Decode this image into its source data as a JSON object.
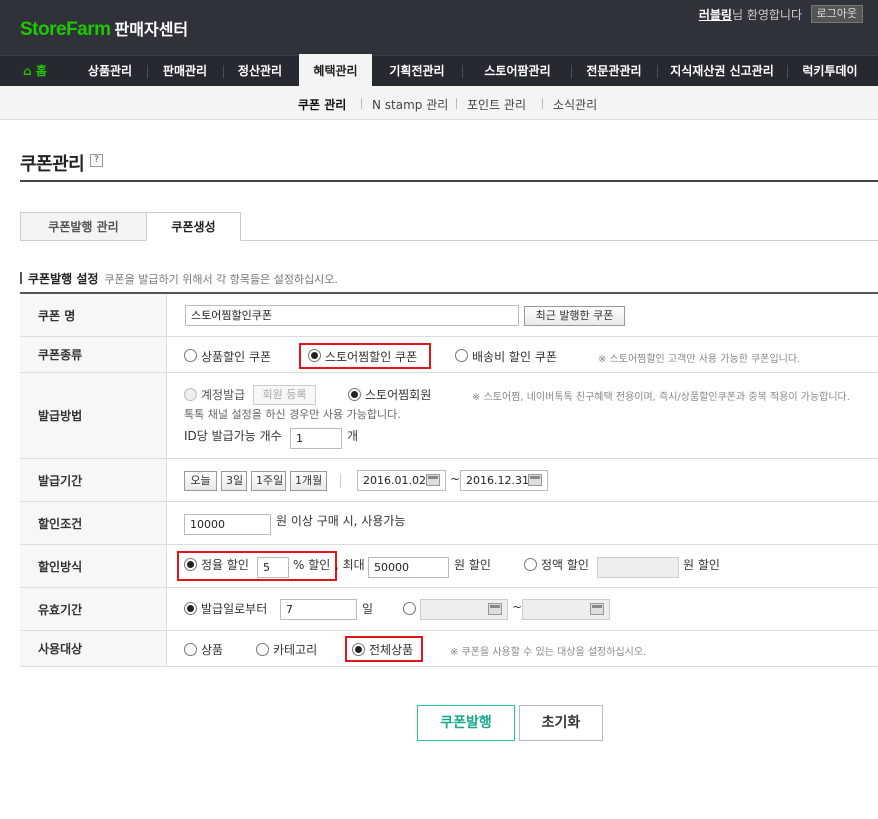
{
  "header": {
    "logo_brand": "StoreFarm",
    "logo_suffix": "판매자센터",
    "user_name": "러블링",
    "welcome_suffix": "님 환영합니다",
    "logout_label": "로그아웃"
  },
  "main_nav": {
    "home_label": "홈",
    "items": [
      "상품관리",
      "판매관리",
      "정산관리",
      "혜택관리",
      "기획전관리",
      "스토어팜관리",
      "전문관관리",
      "지식재산권 신고관리",
      "럭키투데이"
    ],
    "active": "혜택관리"
  },
  "sub_nav": {
    "items": [
      "쿠폰 관리",
      "N stamp 관리",
      "포인트 관리",
      "소식관리"
    ],
    "active": "쿠폰 관리"
  },
  "page": {
    "title": "쿠폰관리",
    "help": "?",
    "tabs": [
      "쿠폰발행 관리",
      "쿠폰생성"
    ],
    "active_tab": "쿠폰생성",
    "section_title": "쿠폰발행 설정",
    "section_desc": "쿠폰을 발급하기 위해서 각 항목들은 설정하십시오."
  },
  "form": {
    "coupon_name": {
      "label": "쿠폰 명",
      "value": "스토어찜할인쿠폰",
      "recent_button": "최근 발행한 쿠폰"
    },
    "coupon_type": {
      "label": "쿠폰종류",
      "options": [
        "상품할인 쿠폰",
        "스토어찜할인 쿠폰",
        "배송비 할인 쿠폰"
      ],
      "selected": "스토어찜할인 쿠폰",
      "note": "※ 스토어찜할인 고객만 사용 가능한 쿠폰입니다."
    },
    "issue_method": {
      "label": "발급방법",
      "option_account": "계정발급",
      "member_register_button": "회원 등록",
      "option_store": "스토어찜회원",
      "selected": "스토어찜회원",
      "note": "※ 스토어찜, 네이버톡톡 친구혜택 전용이며, 즉시/상품할인쿠폰과 중복 적용이 가능합니다.",
      "note2": "톡톡 채널 설정을 하신 경우만 사용 가능합니다.",
      "per_id_label": "ID당 발급가능 개수",
      "per_id_value": "1",
      "per_id_unit": "개"
    },
    "issue_period": {
      "label": "발급기간",
      "quick_buttons": [
        "오늘",
        "3일",
        "1주일",
        "1개월"
      ],
      "start_date": "2016.01.02",
      "tilde": "~",
      "end_date": "2016.12.31"
    },
    "discount_condition": {
      "label": "할인조건",
      "value": "10000",
      "suffix": "원 이상 구매 시, 사용가능"
    },
    "discount_method": {
      "label": "할인방식",
      "rate_label": "정율 할인",
      "rate_value": "5",
      "rate_suffix": "% 할인",
      "max_label": ", 최대",
      "max_value": "50000",
      "max_suffix": "원 할인",
      "fixed_label": "정액 할인",
      "fixed_value": "",
      "fixed_suffix": "원 할인",
      "selected": "정율 할인"
    },
    "valid_period": {
      "label": "유효기간",
      "from_issue_label": "발급일로부터",
      "days_value": "7",
      "days_unit": "일",
      "range_start": "",
      "tilde": "~",
      "range_end": "",
      "selected": "발급일로부터"
    },
    "target": {
      "label": "사용대상",
      "options": [
        "상품",
        "카테고리",
        "전체상품"
      ],
      "selected": "전체상품",
      "note": "※ 쿠폰을 사용할 수 있는 대상을 설정하십시오."
    }
  },
  "actions": {
    "issue": "쿠폰발행",
    "reset": "초기화"
  },
  "colors": {
    "brand_green": "#1ec800",
    "highlight_red": "#e0161b",
    "primary_button": "#1ba88a",
    "topbar": "#2f3339"
  }
}
